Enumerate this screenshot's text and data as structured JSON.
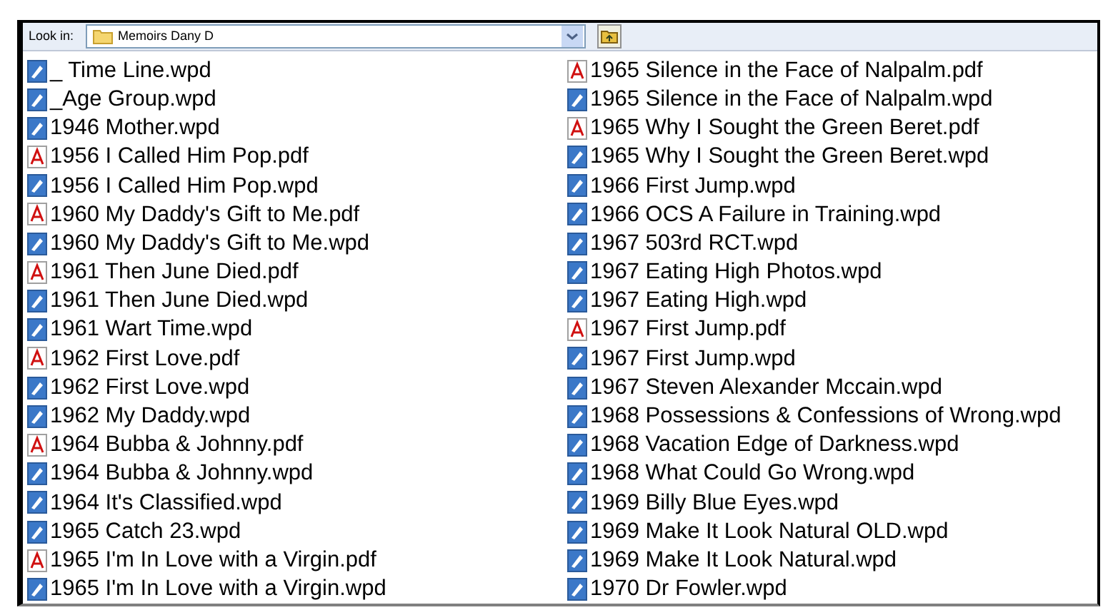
{
  "toolbar": {
    "look_in_label": "Look in:",
    "folder": "Memoirs Dany D"
  },
  "files": [
    {
      "name": "_ Time Line.wpd",
      "kind": "wpd"
    },
    {
      "name": "_Age Group.wpd",
      "kind": "wpd"
    },
    {
      "name": "1946 Mother.wpd",
      "kind": "wpd"
    },
    {
      "name": "1956 I Called Him Pop.pdf",
      "kind": "pdf"
    },
    {
      "name": "1956 I Called Him Pop.wpd",
      "kind": "wpd"
    },
    {
      "name": "1960 My Daddy's Gift to Me.pdf",
      "kind": "pdf"
    },
    {
      "name": "1960 My Daddy's Gift to Me.wpd",
      "kind": "wpd"
    },
    {
      "name": "1961 Then June Died.pdf",
      "kind": "pdf"
    },
    {
      "name": "1961 Then June Died.wpd",
      "kind": "wpd"
    },
    {
      "name": "1961 Wart Time.wpd",
      "kind": "wpd"
    },
    {
      "name": "1962 First Love.pdf",
      "kind": "pdf"
    },
    {
      "name": "1962 First Love.wpd",
      "kind": "wpd"
    },
    {
      "name": "1962 My Daddy.wpd",
      "kind": "wpd"
    },
    {
      "name": "1964 Bubba & Johnny.pdf",
      "kind": "pdf"
    },
    {
      "name": "1964 Bubba & Johnny.wpd",
      "kind": "wpd"
    },
    {
      "name": "1964 It's Classified.wpd",
      "kind": "wpd"
    },
    {
      "name": "1965 Catch 23.wpd",
      "kind": "wpd"
    },
    {
      "name": "1965 I'm In Love with a Virgin.pdf",
      "kind": "pdf"
    },
    {
      "name": "1965 I'm In Love with a Virgin.wpd",
      "kind": "wpd"
    },
    {
      "name": "1965 Silence in the Face of Nalpalm.pdf",
      "kind": "pdf"
    },
    {
      "name": "1965 Silence in the Face of Nalpalm.wpd",
      "kind": "wpd"
    },
    {
      "name": "1965 Why I Sought the Green Beret.pdf",
      "kind": "pdf"
    },
    {
      "name": "1965 Why I Sought the Green Beret.wpd",
      "kind": "wpd"
    },
    {
      "name": "1966 First Jump.wpd",
      "kind": "wpd"
    },
    {
      "name": "1966 OCS A Failure in Training.wpd",
      "kind": "wpd"
    },
    {
      "name": "1967 503rd RCT.wpd",
      "kind": "wpd"
    },
    {
      "name": "1967 Eating High Photos.wpd",
      "kind": "wpd"
    },
    {
      "name": "1967 Eating High.wpd",
      "kind": "wpd"
    },
    {
      "name": "1967 First Jump.pdf",
      "kind": "pdf"
    },
    {
      "name": "1967 First Jump.wpd",
      "kind": "wpd"
    },
    {
      "name": "1967 Steven Alexander Mccain.wpd",
      "kind": "wpd"
    },
    {
      "name": "1968 Possessions & Confessions of Wrong.wpd",
      "kind": "wpd"
    },
    {
      "name": "1968 Vacation Edge of Darkness.wpd",
      "kind": "wpd"
    },
    {
      "name": "1968 What Could Go Wrong.wpd",
      "kind": "wpd"
    },
    {
      "name": "1969 Billy Blue Eyes.wpd",
      "kind": "wpd"
    },
    {
      "name": "1969 Make It Look Natural OLD.wpd",
      "kind": "wpd"
    },
    {
      "name": "1969 Make It Look Natural.wpd",
      "kind": "wpd"
    },
    {
      "name": "1970 Dr Fowler.wpd",
      "kind": "wpd"
    }
  ]
}
